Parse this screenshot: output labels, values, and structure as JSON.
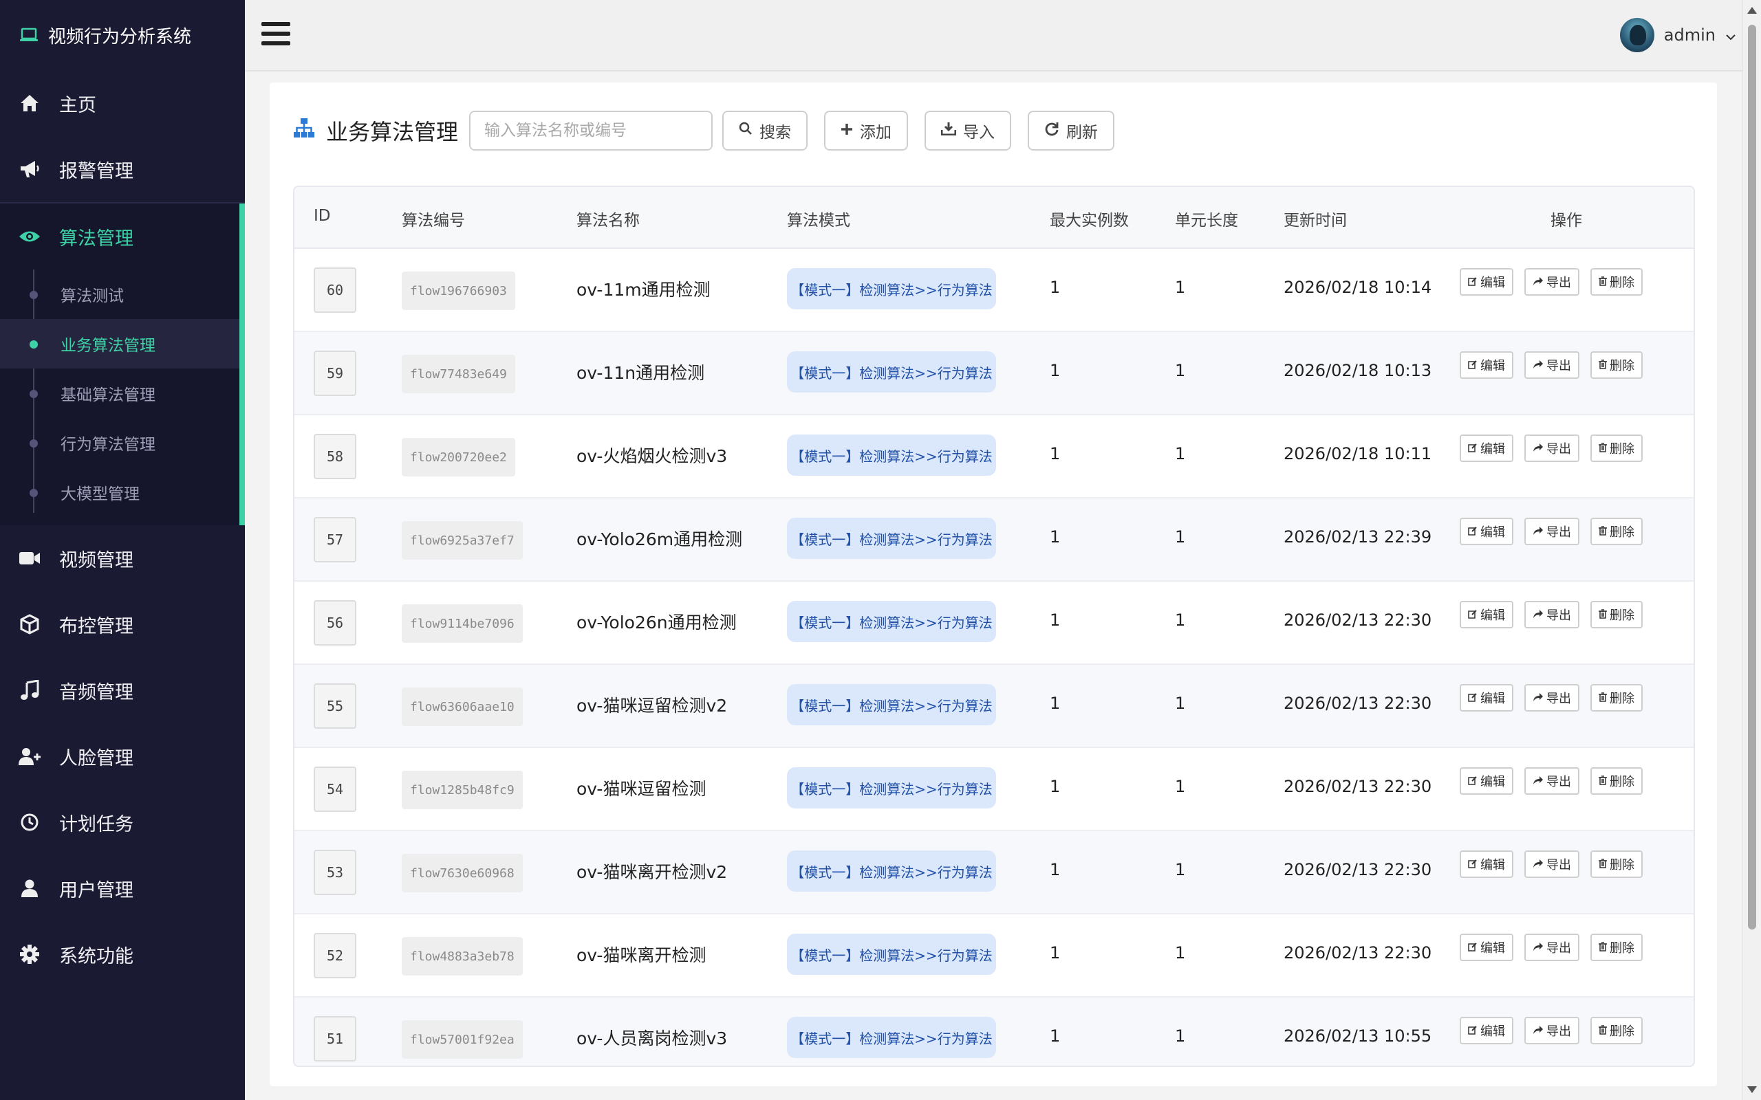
{
  "app": {
    "title": "视频行为分析系统"
  },
  "sidebar": {
    "items": [
      {
        "label": "主页",
        "icon": "home-icon"
      },
      {
        "label": "报警管理",
        "icon": "megaphone-icon"
      },
      {
        "label": "算法管理",
        "icon": "eye-icon"
      },
      {
        "label": "视频管理",
        "icon": "video-camera-icon"
      },
      {
        "label": "布控管理",
        "icon": "cube-icon"
      },
      {
        "label": "音频管理",
        "icon": "music-icon"
      },
      {
        "label": "人脸管理",
        "icon": "user-plus-icon"
      },
      {
        "label": "计划任务",
        "icon": "clock-icon"
      },
      {
        "label": "用户管理",
        "icon": "user-icon"
      },
      {
        "label": "系统功能",
        "icon": "gear-icon"
      }
    ],
    "subitems": [
      {
        "label": "算法测试"
      },
      {
        "label": "业务算法管理"
      },
      {
        "label": "基础算法管理"
      },
      {
        "label": "行为算法管理"
      },
      {
        "label": "大模型管理"
      }
    ],
    "accent_color": "#3fd1a6"
  },
  "header": {
    "username": "admin"
  },
  "page": {
    "title": "业务算法管理",
    "search_placeholder": "输入算法名称或编号",
    "buttons": {
      "search": "搜索",
      "add": "添加",
      "import": "导入",
      "refresh": "刷新"
    }
  },
  "table": {
    "columns": {
      "id": "ID",
      "code": "算法编号",
      "name": "算法名称",
      "mode": "算法模式",
      "max": "最大实例数",
      "unit": "单元长度",
      "time": "更新时间",
      "ops": "操作"
    },
    "actions": {
      "edit": "编辑",
      "export": "导出",
      "delete": "删除"
    },
    "rows": [
      {
        "id": "60",
        "code": "flow196766903",
        "name": "ov-11m通用检测",
        "mode": "【模式一】检测算法>>行为算法",
        "max": "1",
        "unit": "1",
        "time": "2026/02/18 10:14"
      },
      {
        "id": "59",
        "code": "flow77483e649",
        "name": "ov-11n通用检测",
        "mode": "【模式一】检测算法>>行为算法",
        "max": "1",
        "unit": "1",
        "time": "2026/02/18 10:13"
      },
      {
        "id": "58",
        "code": "flow200720ee2",
        "name": "ov-火焰烟火检测v3",
        "mode": "【模式一】检测算法>>行为算法",
        "max": "1",
        "unit": "1",
        "time": "2026/02/18 10:11"
      },
      {
        "id": "57",
        "code": "flow6925a37ef7",
        "name": "ov-Yolo26m通用检测",
        "mode": "【模式一】检测算法>>行为算法",
        "max": "1",
        "unit": "1",
        "time": "2026/02/13 22:39"
      },
      {
        "id": "56",
        "code": "flow9114be7096",
        "name": "ov-Yolo26n通用检测",
        "mode": "【模式一】检测算法>>行为算法",
        "max": "1",
        "unit": "1",
        "time": "2026/02/13 22:30"
      },
      {
        "id": "55",
        "code": "flow63606aae10",
        "name": "ov-猫咪逗留检测v2",
        "mode": "【模式一】检测算法>>行为算法",
        "max": "1",
        "unit": "1",
        "time": "2026/02/13 22:30"
      },
      {
        "id": "54",
        "code": "flow1285b48fc9",
        "name": "ov-猫咪逗留检测",
        "mode": "【模式一】检测算法>>行为算法",
        "max": "1",
        "unit": "1",
        "time": "2026/02/13 22:30"
      },
      {
        "id": "53",
        "code": "flow7630e60968",
        "name": "ov-猫咪离开检测v2",
        "mode": "【模式一】检测算法>>行为算法",
        "max": "1",
        "unit": "1",
        "time": "2026/02/13 22:30"
      },
      {
        "id": "52",
        "code": "flow4883a3eb78",
        "name": "ov-猫咪离开检测",
        "mode": "【模式一】检测算法>>行为算法",
        "max": "1",
        "unit": "1",
        "time": "2026/02/13 22:30"
      },
      {
        "id": "51",
        "code": "flow57001f92ea",
        "name": "ov-人员离岗检测v3",
        "mode": "【模式一】检测算法>>行为算法",
        "max": "1",
        "unit": "1",
        "time": "2026/02/13 10:55"
      }
    ]
  }
}
